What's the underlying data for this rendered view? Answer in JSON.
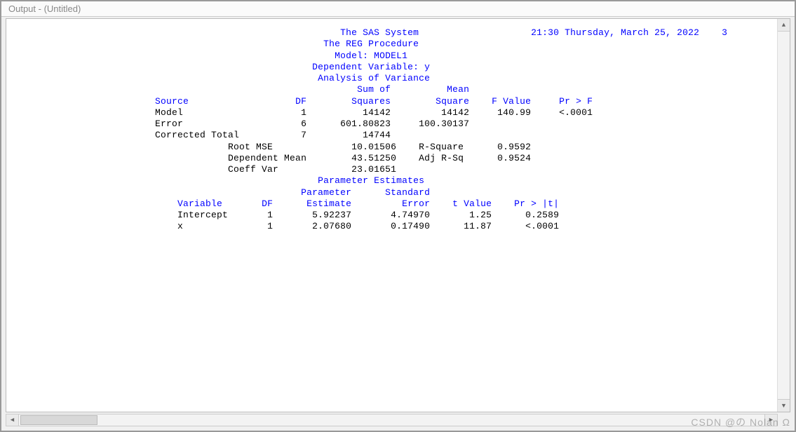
{
  "window": {
    "title": "Output - (Untitled)"
  },
  "page": {
    "system_title": "The SAS System",
    "datetime": "21:30 Thursday, March 25, 2022",
    "page_num": "3",
    "proc_line": "The REG Procedure",
    "model_line": "Model: MODEL1",
    "depvar_line": "Dependent Variable: y",
    "anova_title": "Analysis of Variance",
    "anova_headers": {
      "source": "Source",
      "df": "DF",
      "ss1": "Sum of",
      "ss2": "Squares",
      "ms1": "Mean",
      "ms2": "Square",
      "fv": "F Value",
      "pf": "Pr > F"
    },
    "anova_rows": [
      {
        "source": "Model",
        "df": "1",
        "ss": "14142",
        "ms": "14142",
        "fv": "140.99",
        "pf": "<.0001"
      },
      {
        "source": "Error",
        "df": "6",
        "ss": "601.80823",
        "ms": "100.30137",
        "fv": "",
        "pf": ""
      },
      {
        "source": "Corrected Total",
        "df": "7",
        "ss": "14744",
        "ms": "",
        "fv": "",
        "pf": ""
      }
    ],
    "fit": [
      {
        "label": "Root MSE",
        "value": "10.01506",
        "rlabel": "R-Square",
        "rvalue": "0.9592"
      },
      {
        "label": "Dependent Mean",
        "value": "43.51250",
        "rlabel": "Adj R-Sq",
        "rvalue": "0.9524"
      },
      {
        "label": "Coeff Var",
        "value": "23.01651",
        "rlabel": "",
        "rvalue": ""
      }
    ],
    "param_title": "Parameter Estimates",
    "param_headers": {
      "variable": "Variable",
      "df": "DF",
      "pe1": "Parameter",
      "pe2": "Estimate",
      "se1": "Standard",
      "se2": "Error",
      "tv": "t Value",
      "pt": "Pr > |t|"
    },
    "param_rows": [
      {
        "variable": "Intercept",
        "df": "1",
        "est": "5.92237",
        "se": "4.74970",
        "tv": "1.25",
        "pt": "0.2589"
      },
      {
        "variable": "x",
        "df": "1",
        "est": "2.07680",
        "se": "0.17490",
        "tv": "11.87",
        "pt": "<.0001"
      }
    ]
  },
  "watermark": "CSDN @の Nolan Ω"
}
